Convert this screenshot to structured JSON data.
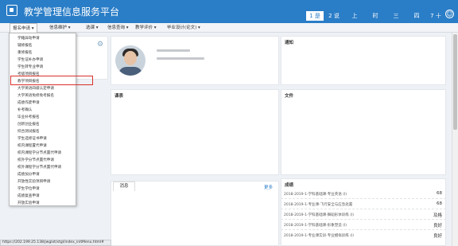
{
  "header": {
    "title": "教学管理信息服务平台",
    "calendar": [
      {
        "label": "1 是",
        "active": true
      },
      {
        "label": "2 说"
      },
      {
        "label": "上"
      },
      {
        "label": "时"
      },
      {
        "label": "三"
      },
      {
        "label": "四"
      },
      {
        "label": "7 十"
      }
    ]
  },
  "nav": {
    "items": [
      "报名申请",
      "信息维护",
      "选课",
      "信息查询",
      "教学评价",
      "毕业设计(论文)"
    ]
  },
  "dropdown": {
    "items": [
      "学籍异动申请",
      "辅修报名",
      "重修报名",
      "学生证补办申请",
      "学生转专业申请",
      "考级项目报名",
      "教学项目报名",
      "大学英语四级认定申请",
      "大学英语免修免考报名",
      "成绩作废申请",
      "补考确认",
      "毕业补考报名",
      "创新创业报名",
      "综合测试报名",
      "学生选修证书申请",
      "校内课程置代申请",
      "校内课程学分节点置代申请",
      "校外学分节点置代申请",
      "校外课程学分节点置代申请",
      "成绩加分申请",
      "开放性实验项目申请",
      "学生学位申请",
      "成绩复查申请",
      "开放实验申请"
    ]
  },
  "panels": {
    "notice": "通知",
    "courses": "课表",
    "files": "文件",
    "grades": "成绩",
    "messages": "消息",
    "more": "更多"
  },
  "grades": [
    {
      "name": "2018-2019-1-学科基础课-专业英语 (I)",
      "score": "68"
    },
    {
      "name": "2018-2019-1-专业课-飞行安全与应急处置",
      "score": "68"
    },
    {
      "name": "2018-2019-1-学科基础课-舞蹈形体训练 (I)",
      "score": "及格"
    },
    {
      "name": "2018-2019-1-学科基础课-形象塑造 (I)",
      "score": "良好"
    },
    {
      "name": "2018-2019-1-专业课实训-专业模拟训练 (I)",
      "score": "良好"
    }
  ],
  "status": {
    "url": "https://202.199.25.138/jwglxt/xtgl/index_initMenu.html#"
  },
  "colors": {
    "header": "#2a7dc7",
    "highlight": "#d9302c"
  }
}
